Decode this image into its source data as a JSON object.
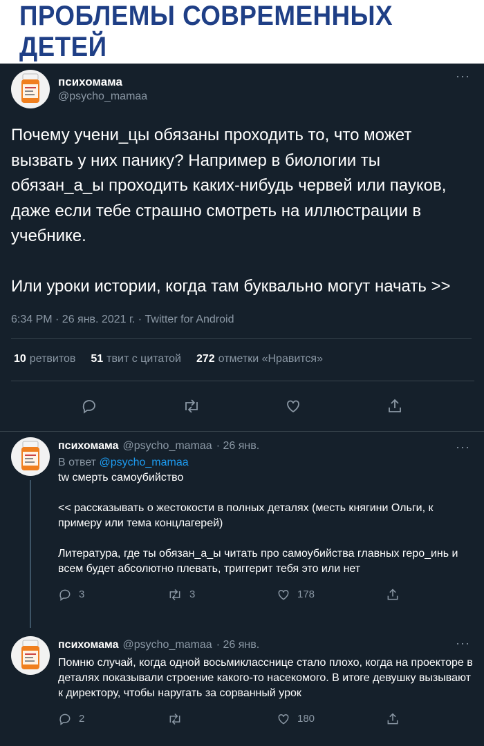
{
  "banner": {
    "title": "ПРОБЛЕМЫ СОВРЕМЕННЫХ ДЕТЕЙ"
  },
  "main_tweet": {
    "name": "психомама",
    "handle": "@psycho_mamaa",
    "more": "···",
    "text": "Почему учени_цы обязаны проходить то, что может вызвать у них панику? Например в биологии ты обязан_а_ы проходить каких-нибудь червей или пауков, даже если тебе страшно смотреть на иллюстрации в учебнике.\n\nИли уроки истории, когда там буквально могут начать >>",
    "meta": "6:34 PM · 26 янв. 2021 г. · Twitter for Android",
    "stats": {
      "retweets_count": "10",
      "retweets_label": "ретвитов",
      "quotes_count": "51",
      "quotes_label": "твит с цитатой",
      "likes_count": "272",
      "likes_label": "отметки «Нравится»"
    },
    "icons": [
      "reply-icon",
      "retweet-icon",
      "like-icon",
      "share-icon"
    ]
  },
  "replies": [
    {
      "name": "психомама",
      "handle": "@psycho_mamaa",
      "time": "· 26 янв.",
      "reply_to_label": "В ответ",
      "reply_to_handle": "@psycho_mamaa",
      "text": "tw смерть самоубийство\n\n<< рассказывать о жестокости в полных деталях (месть княгини Ольги, к примеру или тема концлагерей)\n\nЛитература, где ты обязан_а_ы читать про самоубийства главных геро_инь и всем будет абсолютно плевать, триггерит тебя это или нет",
      "replies": "3",
      "retweets": "3",
      "likes": "178"
    },
    {
      "name": "психомама",
      "handle": "@psycho_mamaa",
      "time": "· 26 янв.",
      "text": "Помню случай, когда одной восьмикласснице стало плохо, когда на проекторе в деталях показывали строение какого-то насекомого. В итоге девушку вызывают к директору, чтобы наругать за сорванный урок",
      "replies": "2",
      "retweets": "",
      "likes": "180"
    }
  ],
  "colors": {
    "background": "#15202b",
    "banner_text": "#1f3f86",
    "link": "#1d9bf0",
    "secondary": "#8b98a5"
  }
}
